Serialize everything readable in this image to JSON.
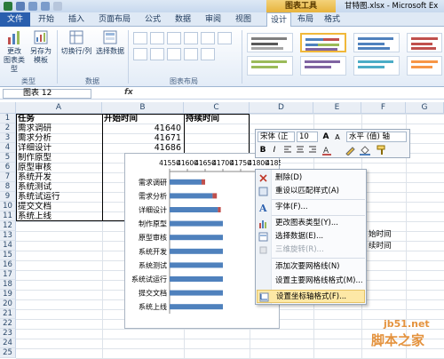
{
  "window": {
    "chart_tools_tab": "图表工具",
    "filename": "甘特图.xlsx - Microsoft Ex"
  },
  "tabs": [
    {
      "label": "文件"
    },
    {
      "label": "开始"
    },
    {
      "label": "插入"
    },
    {
      "label": "页面布局"
    },
    {
      "label": "公式"
    },
    {
      "label": "数据"
    },
    {
      "label": "审阅"
    },
    {
      "label": "视图"
    },
    {
      "label": "设计"
    },
    {
      "label": "布局"
    },
    {
      "label": "格式"
    }
  ],
  "ribbon": {
    "change_type_label": "更改",
    "change_type_label2": "图表类型",
    "save_template_label": "另存为",
    "save_template_label2": "模板",
    "switch_row_col_label": "切换行/列",
    "select_data_label": "选择数据",
    "group_type": "类型",
    "group_data": "数据",
    "group_layout": "图表布局"
  },
  "formula_bar": {
    "name_box": "图表 12",
    "fx": "fx"
  },
  "columns": [
    "A",
    "B",
    "C",
    "D",
    "E",
    "F",
    "G"
  ],
  "rows": [
    "1",
    "2",
    "3",
    "4",
    "5",
    "6",
    "7",
    "8",
    "9",
    "10",
    "11",
    "12",
    "13",
    "14",
    "15",
    "16",
    "17",
    "18",
    "19",
    "20",
    "21",
    "22",
    "23",
    "24",
    "25"
  ],
  "table": {
    "headers": [
      "任务",
      "开始时间",
      "持续时间"
    ],
    "tasks": [
      "需求调研",
      "需求分析",
      "详细设计",
      "制作原型",
      "原型审核",
      "系统开发",
      "系统测试",
      "系统试运行",
      "提交文档",
      "系统上线"
    ],
    "start_values": [
      "41640",
      "41671",
      "41686"
    ]
  },
  "chart_data": {
    "type": "bar",
    "orientation": "horizontal",
    "stacked": true,
    "categories": [
      "需求调研",
      "需求分析",
      "详细设计",
      "制作原型",
      "原型审核",
      "系统开发",
      "系统测试",
      "系统试运行",
      "提交文档",
      "系统上线"
    ],
    "series": [
      {
        "values": [
          41640,
          41671,
          41686,
          41700,
          41700,
          41700,
          41700,
          41700,
          41700,
          41700
        ],
        "color": "#4f81bd"
      },
      {
        "values": [
          10,
          12,
          8,
          0,
          0,
          0,
          0,
          0,
          0,
          0
        ],
        "color": "#c0504d"
      }
    ],
    "x_ticks": [
      "41550",
      "41600",
      "41650",
      "41700",
      "41750",
      "41800",
      "41850"
    ],
    "xlim": [
      41550,
      41850
    ]
  },
  "mini_toolbar": {
    "font": "宋体 (正",
    "size": "10",
    "grow": "A",
    "shrink": "A",
    "axis_label": "水平 (值) 轴",
    "bold": "B",
    "italic": "I"
  },
  "context_menu": {
    "items": [
      {
        "label": "删除(D)",
        "icon": "delete-icon",
        "disabled": false
      },
      {
        "label": "重设以匹配样式(A)",
        "icon": "reset-style-icon",
        "disabled": false
      },
      {
        "label": "字体(F)...",
        "icon": "font-icon",
        "disabled": false
      },
      {
        "label": "更改图表类型(Y)...",
        "icon": "chart-type-icon",
        "disabled": false
      },
      {
        "label": "选择数据(E)...",
        "icon": "select-data-icon",
        "disabled": false
      },
      {
        "label": "三维旋转(R)...",
        "icon": "rotate-3d-icon",
        "disabled": true
      },
      {
        "label": "添加次要网格线(N)",
        "icon": "",
        "disabled": false
      },
      {
        "label": "设置主要网格线格式(M)...",
        "icon": "",
        "disabled": false
      },
      {
        "label": "设置坐标轴格式(F)...",
        "icon": "format-axis-icon",
        "disabled": false
      }
    ]
  },
  "side_text": {
    "line1": "始时间",
    "line2": "续时间"
  },
  "watermark": {
    "domain": "jb51.net",
    "name": "脚本之家"
  }
}
